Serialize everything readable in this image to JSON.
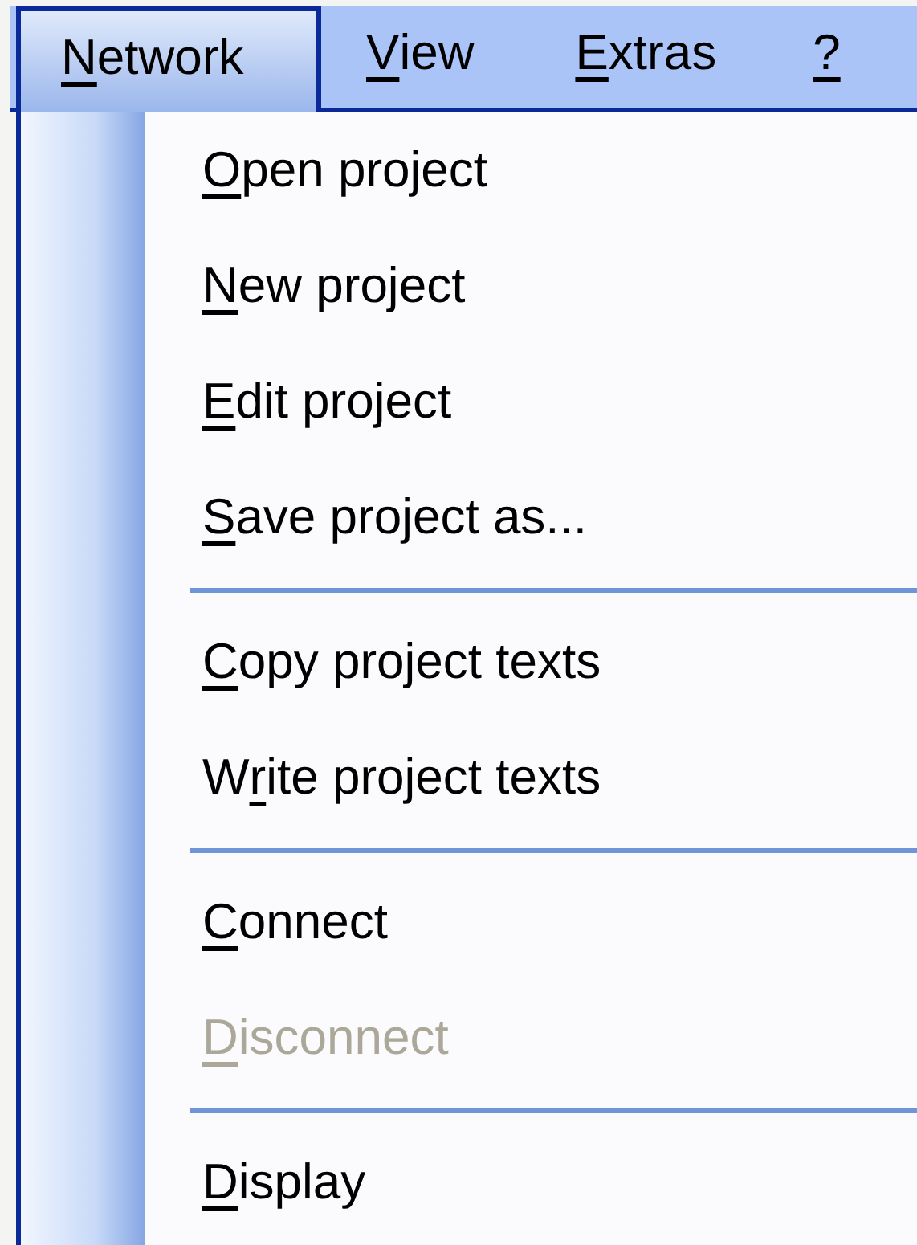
{
  "menu_bar": [
    {
      "key": "N",
      "after": "etwork",
      "selected": true
    },
    {
      "key": "V",
      "after": "iew",
      "selected": false
    },
    {
      "key": "E",
      "after": "xtras",
      "selected": false
    },
    {
      "key": "?",
      "selected": false
    }
  ],
  "menu": {
    "items": [
      {
        "kind": "item",
        "key": "O",
        "after": "pen project",
        "disabled": false
      },
      {
        "kind": "item",
        "key": "N",
        "after": "ew project",
        "disabled": false
      },
      {
        "kind": "item",
        "key": "E",
        "after": "dit project",
        "disabled": false
      },
      {
        "kind": "item",
        "key": "S",
        "after": "ave project as...",
        "disabled": false
      },
      {
        "kind": "separator"
      },
      {
        "kind": "item",
        "key": "C",
        "after": "opy project texts",
        "disabled": false
      },
      {
        "kind": "item",
        "before": "W",
        "key": "r",
        "after": "ite project texts",
        "disabled": false
      },
      {
        "kind": "separator"
      },
      {
        "kind": "item",
        "key": "C",
        "after": "onnect",
        "disabled": false
      },
      {
        "kind": "item",
        "key": "D",
        "after": "isconnect",
        "disabled": true
      },
      {
        "kind": "separator"
      },
      {
        "kind": "item",
        "key": "D",
        "after": "isplay",
        "disabled": false
      }
    ]
  }
}
